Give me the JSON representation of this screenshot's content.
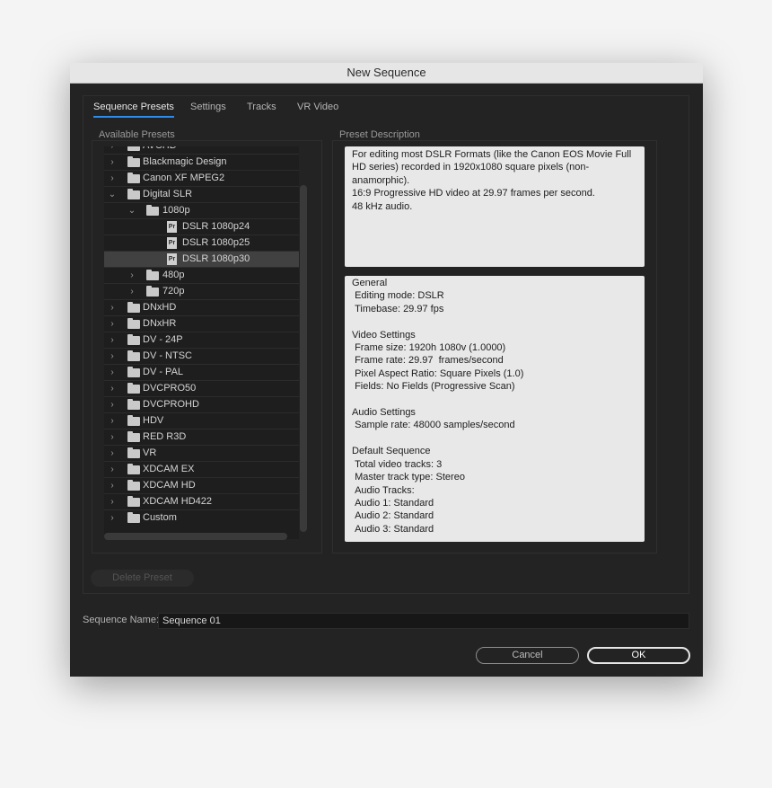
{
  "window": {
    "title": "New Sequence"
  },
  "tabs": [
    {
      "label": "Sequence Presets"
    },
    {
      "label": "Settings"
    },
    {
      "label": "Tracks"
    },
    {
      "label": "VR Video"
    }
  ],
  "presets": {
    "label": "Available Presets",
    "tree": [
      {
        "label": "AVCHD"
      },
      {
        "label": "Blackmagic Design"
      },
      {
        "label": "Canon XF MPEG2"
      },
      {
        "label": "Digital SLR"
      },
      {
        "label": "1080p"
      },
      {
        "label": "DSLR 1080p24"
      },
      {
        "label": "DSLR 1080p25"
      },
      {
        "label": "DSLR 1080p30"
      },
      {
        "label": "480p"
      },
      {
        "label": "720p"
      },
      {
        "label": "DNxHD"
      },
      {
        "label": "DNxHR"
      },
      {
        "label": "DV - 24P"
      },
      {
        "label": "DV - NTSC"
      },
      {
        "label": "DV - PAL"
      },
      {
        "label": "DVCPRO50"
      },
      {
        "label": "DVCPROHD"
      },
      {
        "label": "HDV"
      },
      {
        "label": "RED R3D"
      },
      {
        "label": "VR"
      },
      {
        "label": "XDCAM EX"
      },
      {
        "label": "XDCAM HD"
      },
      {
        "label": "XDCAM HD422"
      },
      {
        "label": "Custom"
      }
    ],
    "preset_icon_text": "Pr",
    "delete_label": "Delete Preset"
  },
  "description": {
    "label": "Preset Description",
    "summary": "For editing most DSLR Formats (like the Canon EOS Movie Full HD series) recorded in 1920x1080 square pixels (non-anamorphic).\n16:9 Progressive HD video at 29.97 frames per second.\n48 kHz audio.",
    "details": "General\n Editing mode: DSLR\n Timebase: 29.97 fps\n\nVideo Settings\n Frame size: 1920h 1080v (1.0000)\n Frame rate: 29.97  frames/second\n Pixel Aspect Ratio: Square Pixels (1.0)\n Fields: No Fields (Progressive Scan)\n\nAudio Settings\n Sample rate: 48000 samples/second\n\nDefault Sequence\n Total video tracks: 3\n Master track type: Stereo\n Audio Tracks:\n Audio 1: Standard\n Audio 2: Standard\n Audio 3: Standard"
  },
  "sequence_name": {
    "label": "Sequence Name:",
    "value": "Sequence 01"
  },
  "buttons": {
    "cancel": "Cancel",
    "ok": "OK"
  }
}
